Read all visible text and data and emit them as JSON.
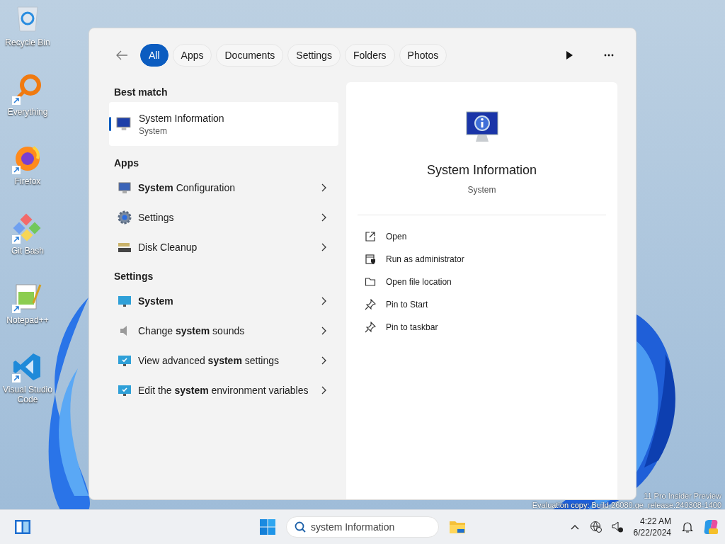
{
  "desktop_icons": [
    {
      "label": "Recycle Bin",
      "kind": "recycle",
      "shortcut": false
    },
    {
      "label": "Everything",
      "kind": "ring",
      "shortcut": true
    },
    {
      "label": "Firefox",
      "kind": "browser",
      "shortcut": true
    },
    {
      "label": "Git Bash",
      "kind": "diamond",
      "shortcut": true
    },
    {
      "label": "Notepad++",
      "kind": "notepad",
      "shortcut": true
    },
    {
      "label": "Visual Studio Code",
      "kind": "code",
      "shortcut": true
    }
  ],
  "search_panel": {
    "filters": [
      {
        "label": "All",
        "selected": true
      },
      {
        "label": "Apps",
        "selected": false
      },
      {
        "label": "Documents",
        "selected": false
      },
      {
        "label": "Settings",
        "selected": false
      },
      {
        "label": "Folders",
        "selected": false
      },
      {
        "label": "Photos",
        "selected": false
      }
    ],
    "best_match": {
      "heading": "Best match",
      "title": "System Information",
      "subtitle": "System",
      "selected": true
    },
    "sections": [
      {
        "heading": "Apps",
        "items": [
          {
            "label": "**System** Configuration",
            "kind": "monitor-app"
          },
          {
            "label": "Settings",
            "kind": "gear"
          },
          {
            "label": "Disk Cleanup",
            "kind": "disk"
          }
        ]
      },
      {
        "heading": "Settings",
        "items": [
          {
            "label": "**System**",
            "kind": "monitor"
          },
          {
            "label": "Change **system** sounds",
            "kind": "speaker"
          },
          {
            "label": "View advanced **system** settings",
            "kind": "monitor-check"
          },
          {
            "label": "Edit the **system** environment variables",
            "kind": "monitor-check"
          }
        ]
      }
    ],
    "preview": {
      "title": "System Information",
      "subtitle": "System",
      "actions": [
        {
          "label": "Open",
          "kind": "open"
        },
        {
          "label": "Run as administrator",
          "kind": "admin"
        },
        {
          "label": "Open file location",
          "kind": "folder"
        },
        {
          "label": "Pin to Start",
          "kind": "pin"
        },
        {
          "label": "Pin to taskbar",
          "kind": "pin"
        }
      ]
    }
  },
  "watermark": [
    "11 Pro Insider Preview",
    "Evaluation copy: Build 26080.ge_release.240308-1400"
  ],
  "taskbar": {
    "search": {
      "value": "system Information"
    },
    "time": "4:22 AM",
    "date": "6/22/2024"
  }
}
